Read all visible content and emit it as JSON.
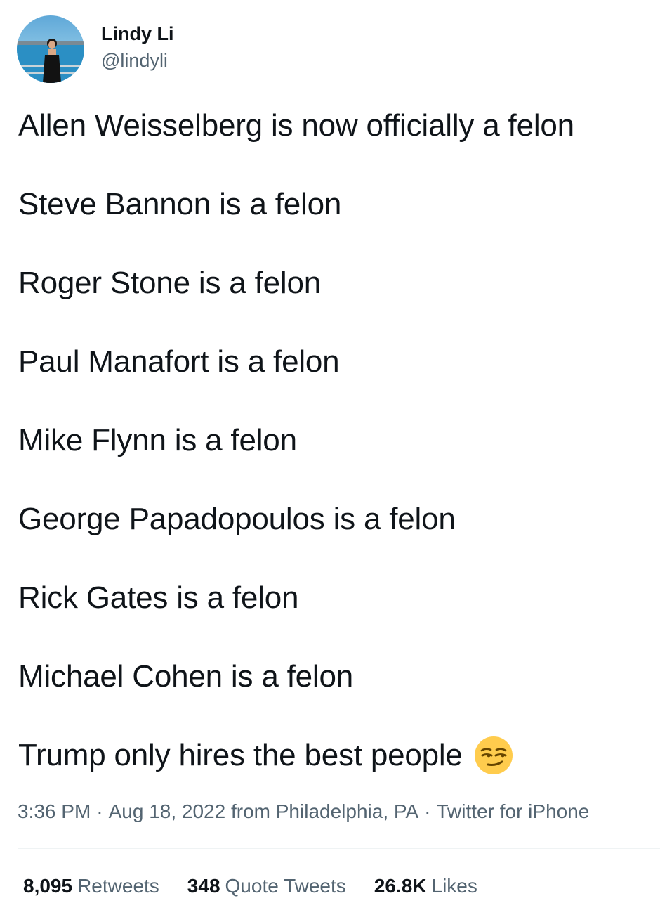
{
  "author": {
    "display_name": "Lindy Li",
    "handle": "@lindyli"
  },
  "tweet": {
    "lines": [
      "Allen Weisselberg is now officially a felon",
      "Steve Bannon is a felon",
      "Roger Stone is a felon",
      "Paul Manafort is a felon",
      "Mike Flynn is a felon",
      "George Papadopoulos is a felon",
      "Rick Gates is a felon",
      "Michael Cohen is a felon",
      "Trump only hires the best people"
    ],
    "trailing_emoji": "smirking-face-emoji"
  },
  "meta": {
    "time": "3:36 PM",
    "date_location": "Aug 18, 2022 from Philadelphia, PA",
    "source": "Twitter for iPhone",
    "separator": "·"
  },
  "stats": {
    "retweets_count": "8,095",
    "retweets_label": "Retweets",
    "quotes_count": "348",
    "quotes_label": "Quote Tweets",
    "likes_count": "26.8K",
    "likes_label": "Likes"
  },
  "colors": {
    "text_primary": "#0f1419",
    "text_secondary": "#536471",
    "divider": "#eff3f4",
    "emoji_yellow": "#ffcc4d"
  }
}
